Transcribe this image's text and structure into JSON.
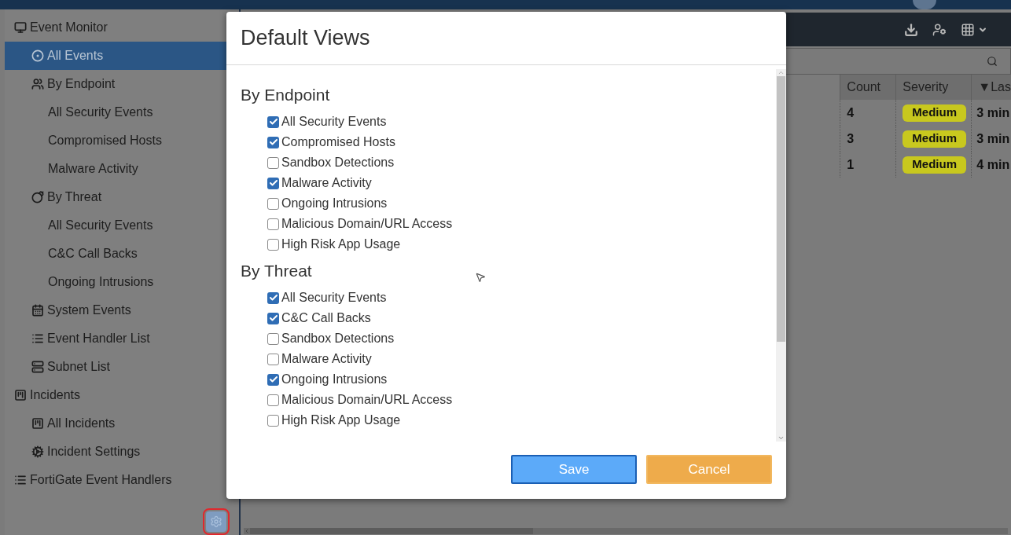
{
  "sidebar": {
    "items": [
      {
        "label": "Event Monitor",
        "selected": false,
        "children": [
          {
            "label": "All Events",
            "selected": true
          },
          {
            "label": "By Endpoint",
            "selected": false,
            "children": [
              {
                "label": "All Security Events",
                "selected": false
              },
              {
                "label": "Compromised Hosts",
                "selected": false
              },
              {
                "label": "Malware Activity",
                "selected": false
              }
            ]
          },
          {
            "label": "By Threat",
            "selected": false,
            "children": [
              {
                "label": "All Security Events",
                "selected": false
              },
              {
                "label": "C&C Call Backs",
                "selected": false
              },
              {
                "label": "Ongoing Intrusions",
                "selected": false
              }
            ]
          },
          {
            "label": "System Events",
            "selected": false
          },
          {
            "label": "Event Handler List",
            "selected": false
          },
          {
            "label": "Subnet List",
            "selected": false
          }
        ]
      },
      {
        "label": "Incidents",
        "selected": false,
        "children": [
          {
            "label": "All Incidents",
            "selected": false
          },
          {
            "label": "Incident Settings",
            "selected": false
          }
        ]
      },
      {
        "label": "FortiGate Event Handlers",
        "selected": false
      }
    ]
  },
  "table": {
    "columns": [
      "Count",
      "Severity",
      "▼Las"
    ],
    "rows": [
      {
        "count": "4",
        "severity": "Medium",
        "color": "#c8c81e",
        "last": "3 min"
      },
      {
        "count": "3",
        "severity": "Medium",
        "color": "#c8c81e",
        "last": "3 min"
      },
      {
        "count": "1",
        "severity": "Medium",
        "color": "#c8c81e",
        "last": "4 min"
      }
    ]
  },
  "dialog": {
    "title": "Default Views",
    "sections": [
      {
        "heading": "By Endpoint",
        "options": [
          {
            "label": "All Security Events",
            "checked": true
          },
          {
            "label": "Compromised Hosts",
            "checked": true
          },
          {
            "label": "Sandbox Detections",
            "checked": false
          },
          {
            "label": "Malware Activity",
            "checked": true
          },
          {
            "label": "Ongoing Intrusions",
            "checked": false
          },
          {
            "label": "Malicious Domain/URL Access",
            "checked": false
          },
          {
            "label": "High Risk App Usage",
            "checked": false
          }
        ]
      },
      {
        "heading": "By Threat",
        "options": [
          {
            "label": "All Security Events",
            "checked": true
          },
          {
            "label": "C&C Call Backs",
            "checked": true
          },
          {
            "label": "Sandbox Detections",
            "checked": false
          },
          {
            "label": "Malware Activity",
            "checked": false
          },
          {
            "label": "Ongoing Intrusions",
            "checked": true
          },
          {
            "label": "Malicious Domain/URL Access",
            "checked": false
          },
          {
            "label": "High Risk App Usage",
            "checked": false
          }
        ]
      }
    ],
    "buttons": [
      {
        "label": "Save",
        "kind": "primary"
      },
      {
        "label": "Cancel",
        "kind": "secondary"
      }
    ]
  }
}
